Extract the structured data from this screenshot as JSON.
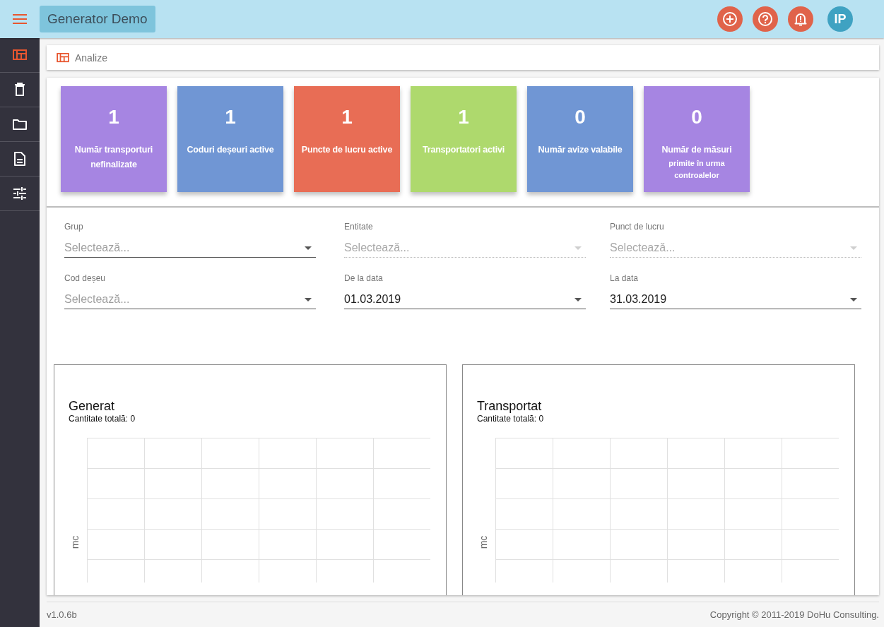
{
  "header": {
    "app_title": "Generator Demo",
    "avatar_initials": "IP"
  },
  "sidebar": {
    "items": [
      {
        "selected": true
      },
      {
        "selected": false
      },
      {
        "selected": false
      },
      {
        "selected": false
      },
      {
        "selected": false
      }
    ]
  },
  "breadcrumb": {
    "label": "Analize"
  },
  "stats": [
    {
      "value": "1",
      "label": "Număr transporturi nefinalizate",
      "color": "#a685e2"
    },
    {
      "value": "1",
      "label": "Coduri deșeuri active",
      "color": "#7096d4"
    },
    {
      "value": "1",
      "label": "Puncte de lucru active",
      "color": "#e86d55"
    },
    {
      "value": "1",
      "label": "Transportatori activi",
      "color": "#aed96d"
    },
    {
      "value": "0",
      "label": "Număr avize valabile",
      "color": "#7096d4"
    },
    {
      "value": "0",
      "label": "Număr de măsuri",
      "sublabel": "primite în urma controalelor",
      "color": "#a685e2"
    }
  ],
  "filters": [
    {
      "label": "Grup",
      "placeholder": "Selectează...",
      "disabled": false
    },
    {
      "label": "Entitate",
      "placeholder": "Selectează...",
      "disabled": true
    },
    {
      "label": "Punct de lucru",
      "placeholder": "Selectează...",
      "disabled": true
    },
    {
      "label": "Cod deșeu",
      "placeholder": "Selectează...",
      "disabled": false
    },
    {
      "label": "De la data",
      "value": "01.03.2019",
      "disabled": false
    },
    {
      "label": "La data",
      "value": "31.03.2019",
      "disabled": false
    }
  ],
  "charts": [
    {
      "title": "Generat",
      "total": "Cantitate totală: 0",
      "ylabel": "mc"
    },
    {
      "title": "Transportat",
      "total": "Cantitate totală: 0",
      "ylabel": "mc"
    }
  ],
  "footer": {
    "version": "v1.0.6b",
    "copyright": "Copyright © 2011-2019 DoHu Consulting."
  }
}
